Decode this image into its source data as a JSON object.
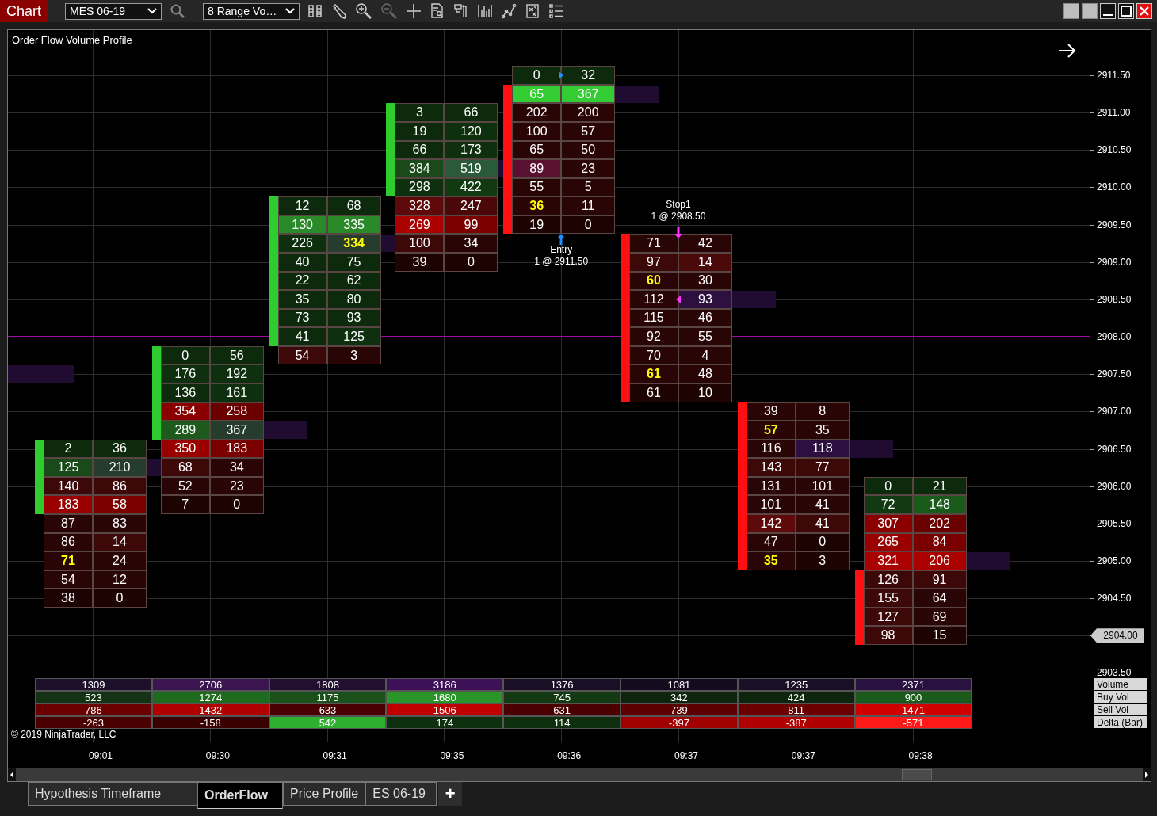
{
  "toolbar": {
    "title": "Chart",
    "instrument": "MES 06-19",
    "bar_type": "8 Range Vo…"
  },
  "chart": {
    "title": "Order Flow Volume Profile",
    "axis_labels": [
      {
        "text": "2911.50",
        "current": false
      },
      {
        "text": "2911.00",
        "current": false
      },
      {
        "text": "2910.50",
        "current": false
      },
      {
        "text": "2910.00",
        "current": false
      },
      {
        "text": "2909.50",
        "current": false
      },
      {
        "text": "2909.00",
        "current": false
      },
      {
        "text": "2908.50",
        "current": false
      },
      {
        "text": "2908.00",
        "current": false
      },
      {
        "text": "2907.50",
        "current": false
      },
      {
        "text": "2907.00",
        "current": false
      },
      {
        "text": "2906.50",
        "current": false
      },
      {
        "text": "2906.00",
        "current": false
      },
      {
        "text": "2905.50",
        "current": false
      },
      {
        "text": "2905.00",
        "current": false
      },
      {
        "text": "2904.50",
        "current": false
      },
      {
        "text": "2904.00",
        "current": true
      },
      {
        "text": "2903.50",
        "current": false
      }
    ],
    "columns": [
      {
        "time": "09:01",
        "kind": "up"
      },
      {
        "time": "09:30",
        "kind": "up"
      },
      {
        "time": "09:31",
        "kind": "up"
      },
      {
        "time": "09:35",
        "kind": "up"
      },
      {
        "time": "09:36",
        "kind": "down",
        "annotation": {
          "kind": "entry",
          "label": "Entry",
          "detail": "1 @ 2911.50"
        }
      },
      {
        "time": "09:37",
        "kind": "down",
        "annotation": {
          "kind": "stop",
          "label": "Stop1",
          "detail": "1 @ 2908.50"
        }
      },
      {
        "time": "09:37",
        "kind": "down"
      },
      {
        "time": "09:38",
        "kind": "down"
      }
    ],
    "ladder": [
      {
        "price_line": false,
        "profile_mark": false,
        "cells": [
          null,
          null,
          null,
          null,
          {
            "bid": {
              "text": "0",
              "color": "#0d2a0d",
              "highlight": false
            },
            "ask": {
              "text": "32",
              "color": "#0d2a0d",
              "highlight": false
            },
            "body": false,
            "poc": false,
            "pointer": {
              "kind": "right",
              "color": "#1e90ff"
            }
          },
          null,
          null,
          null
        ]
      },
      {
        "price_line": false,
        "profile_mark": false,
        "cells": [
          null,
          null,
          null,
          null,
          {
            "bid": {
              "text": "65",
              "color": "#33cc33",
              "highlight": false
            },
            "ask": {
              "text": "367",
              "color": "#33cc33",
              "highlight": false
            },
            "body": true,
            "poc": true
          },
          null,
          null,
          null
        ]
      },
      {
        "price_line": false,
        "profile_mark": false,
        "cells": [
          null,
          null,
          null,
          {
            "bid": {
              "text": "3",
              "color": "#0d2a0d",
              "highlight": false
            },
            "ask": {
              "text": "66",
              "color": "#0d2a0d",
              "highlight": false
            },
            "body": true,
            "poc": false
          },
          {
            "bid": {
              "text": "202",
              "color": "#2a0505",
              "highlight": false
            },
            "ask": {
              "text": "200",
              "color": "#2a0505",
              "highlight": false
            },
            "body": true,
            "poc": false
          },
          null,
          null,
          null
        ]
      },
      {
        "price_line": false,
        "profile_mark": false,
        "cells": [
          null,
          null,
          null,
          {
            "bid": {
              "text": "19",
              "color": "#0d2a0d",
              "highlight": false
            },
            "ask": {
              "text": "120",
              "color": "#0f300f",
              "highlight": false
            },
            "body": true,
            "poc": false
          },
          {
            "bid": {
              "text": "100",
              "color": "#2a0505",
              "highlight": false
            },
            "ask": {
              "text": "57",
              "color": "#2a0505",
              "highlight": false
            },
            "body": true,
            "poc": false
          },
          null,
          null,
          null
        ]
      },
      {
        "price_line": false,
        "profile_mark": false,
        "cells": [
          null,
          null,
          null,
          {
            "bid": {
              "text": "66",
              "color": "#0d2a0d",
              "highlight": false
            },
            "ask": {
              "text": "173",
              "color": "#0f300f",
              "highlight": false
            },
            "body": true,
            "poc": false
          },
          {
            "bid": {
              "text": "65",
              "color": "#2a0505",
              "highlight": false
            },
            "ask": {
              "text": "50",
              "color": "#2a0505",
              "highlight": false
            },
            "body": true,
            "poc": false
          },
          null,
          null,
          null
        ]
      },
      {
        "price_line": false,
        "profile_mark": false,
        "cells": [
          null,
          null,
          null,
          {
            "bid": {
              "text": "384",
              "color": "#1a4a1a",
              "highlight": false
            },
            "ask": {
              "text": "519",
              "color": "#2a5a3a",
              "highlight": false
            },
            "body": true,
            "poc": true
          },
          {
            "bid": {
              "text": "89",
              "color": "#5a1030",
              "highlight": false
            },
            "ask": {
              "text": "23",
              "color": "#2a0505",
              "highlight": false
            },
            "body": true,
            "poc": false
          },
          null,
          null,
          null
        ]
      },
      {
        "price_line": false,
        "profile_mark": false,
        "cells": [
          null,
          null,
          null,
          {
            "bid": {
              "text": "298",
              "color": "#0f300f",
              "highlight": false
            },
            "ask": {
              "text": "422",
              "color": "#123a12",
              "highlight": false
            },
            "body": true,
            "poc": false
          },
          {
            "bid": {
              "text": "55",
              "color": "#2a0505",
              "highlight": false
            },
            "ask": {
              "text": "5",
              "color": "#2a0505",
              "highlight": false
            },
            "body": true,
            "poc": false
          },
          null,
          null,
          null
        ]
      },
      {
        "price_line": false,
        "profile_mark": false,
        "cells": [
          null,
          null,
          {
            "bid": {
              "text": "12",
              "color": "#0d2a0d",
              "highlight": false
            },
            "ask": {
              "text": "68",
              "color": "#0d2a0d",
              "highlight": false
            },
            "body": true,
            "poc": false
          },
          {
            "bid": {
              "text": "328",
              "color": "#5e0a0a",
              "highlight": false
            },
            "ask": {
              "text": "247",
              "color": "#4a0808",
              "highlight": false
            },
            "body": false,
            "poc": false
          },
          {
            "bid": {
              "text": "36",
              "color": "#2a0505",
              "highlight": true
            },
            "ask": {
              "text": "11",
              "color": "#2a0505",
              "highlight": false
            },
            "body": true,
            "poc": false
          },
          null,
          null,
          null
        ]
      },
      {
        "price_line": false,
        "profile_mark": false,
        "cells": [
          null,
          null,
          {
            "bid": {
              "text": "130",
              "color": "#2a8a2a",
              "highlight": false
            },
            "ask": {
              "text": "335",
              "color": "#2a8a2a",
              "highlight": false
            },
            "body": true,
            "poc": false
          },
          {
            "bid": {
              "text": "269",
              "color": "#aa0000",
              "highlight": false
            },
            "ask": {
              "text": "99",
              "color": "#7a0000",
              "highlight": false
            },
            "body": false,
            "poc": false
          },
          {
            "bid": {
              "text": "19",
              "color": "#1e0303",
              "highlight": false
            },
            "ask": {
              "text": "0",
              "color": "#1e0303",
              "highlight": false
            },
            "body": true,
            "poc": false
          },
          null,
          null,
          null
        ]
      },
      {
        "price_line": false,
        "profile_mark": false,
        "cells": [
          null,
          null,
          {
            "bid": {
              "text": "226",
              "color": "#0f300f",
              "highlight": false
            },
            "ask": {
              "text": "334",
              "color": "#263d2e",
              "highlight": true
            },
            "body": true,
            "poc": true
          },
          {
            "bid": {
              "text": "100",
              "color": "#3d0808",
              "highlight": false
            },
            "ask": {
              "text": "34",
              "color": "#2a0505",
              "highlight": false
            },
            "body": false,
            "poc": false
          },
          null,
          {
            "bid": {
              "text": "71",
              "color": "#2a0505",
              "highlight": false
            },
            "ask": {
              "text": "42",
              "color": "#2a0505",
              "highlight": false
            },
            "body": true,
            "poc": false
          },
          null,
          null
        ]
      },
      {
        "price_line": false,
        "profile_mark": false,
        "cells": [
          null,
          null,
          {
            "bid": {
              "text": "40",
              "color": "#0d2a0d",
              "highlight": false
            },
            "ask": {
              "text": "75",
              "color": "#0d2a0d",
              "highlight": false
            },
            "body": true,
            "poc": false
          },
          {
            "bid": {
              "text": "39",
              "color": "#1e0303",
              "highlight": false
            },
            "ask": {
              "text": "0",
              "color": "#1e0303",
              "highlight": false
            },
            "body": false,
            "poc": false
          },
          null,
          {
            "bid": {
              "text": "97",
              "color": "#3d0808",
              "highlight": false
            },
            "ask": {
              "text": "14",
              "color": "#4a0a0a",
              "highlight": false
            },
            "body": true,
            "poc": false
          },
          null,
          null
        ]
      },
      {
        "price_line": false,
        "profile_mark": false,
        "cells": [
          null,
          null,
          {
            "bid": {
              "text": "22",
              "color": "#0d2a0d",
              "highlight": false
            },
            "ask": {
              "text": "62",
              "color": "#0d2a0d",
              "highlight": false
            },
            "body": true,
            "poc": false
          },
          null,
          null,
          {
            "bid": {
              "text": "60",
              "color": "#2a0505",
              "highlight": true
            },
            "ask": {
              "text": "30",
              "color": "#2a0505",
              "highlight": false
            },
            "body": true,
            "poc": false
          },
          null,
          null
        ]
      },
      {
        "price_line": false,
        "profile_mark": false,
        "cells": [
          null,
          null,
          {
            "bid": {
              "text": "35",
              "color": "#0d2a0d",
              "highlight": false
            },
            "ask": {
              "text": "80",
              "color": "#0d2a0d",
              "highlight": false
            },
            "body": true,
            "poc": false
          },
          null,
          null,
          {
            "bid": {
              "text": "112",
              "color": "#2a0505",
              "highlight": false
            },
            "ask": {
              "text": "93",
              "color": "#2e1040",
              "highlight": false
            },
            "body": true,
            "poc": true,
            "pointer": {
              "kind": "left",
              "color": "#ff33ff"
            }
          },
          null,
          null
        ]
      },
      {
        "price_line": false,
        "profile_mark": false,
        "cells": [
          null,
          null,
          {
            "bid": {
              "text": "73",
              "color": "#0d2a0d",
              "highlight": false
            },
            "ask": {
              "text": "93",
              "color": "#0d2a0d",
              "highlight": false
            },
            "body": true,
            "poc": false
          },
          null,
          null,
          {
            "bid": {
              "text": "115",
              "color": "#2a0505",
              "highlight": false
            },
            "ask": {
              "text": "46",
              "color": "#2a0505",
              "highlight": false
            },
            "body": true,
            "poc": false
          },
          null,
          null
        ]
      },
      {
        "price_line": true,
        "profile_mark": false,
        "cells": [
          null,
          null,
          {
            "bid": {
              "text": "41",
              "color": "#0d2a0d",
              "highlight": false
            },
            "ask": {
              "text": "125",
              "color": "#0f300f",
              "highlight": false
            },
            "body": true,
            "poc": false
          },
          null,
          null,
          {
            "bid": {
              "text": "92",
              "color": "#2a0505",
              "highlight": false
            },
            "ask": {
              "text": "55",
              "color": "#2a0505",
              "highlight": false
            },
            "body": true,
            "poc": false
          },
          null,
          null
        ]
      },
      {
        "price_line": false,
        "profile_mark": false,
        "cells": [
          null,
          {
            "bid": {
              "text": "0",
              "color": "#0d2a0d",
              "highlight": false
            },
            "ask": {
              "text": "56",
              "color": "#0d2a0d",
              "highlight": false
            },
            "body": true,
            "poc": false
          },
          {
            "bid": {
              "text": "54",
              "color": "#3d0808",
              "highlight": false
            },
            "ask": {
              "text": "3",
              "color": "#2a0505",
              "highlight": false
            },
            "body": false,
            "poc": false
          },
          null,
          null,
          {
            "bid": {
              "text": "70",
              "color": "#2a0505",
              "highlight": false
            },
            "ask": {
              "text": "4",
              "color": "#2a0505",
              "highlight": false
            },
            "body": true,
            "poc": false
          },
          null,
          null
        ]
      },
      {
        "price_line": false,
        "profile_mark": true,
        "cells": [
          null,
          {
            "bid": {
              "text": "176",
              "color": "#0f300f",
              "highlight": false
            },
            "ask": {
              "text": "192",
              "color": "#0f300f",
              "highlight": false
            },
            "body": true,
            "poc": false
          },
          null,
          null,
          null,
          {
            "bid": {
              "text": "61",
              "color": "#2a0505",
              "highlight": true
            },
            "ask": {
              "text": "48",
              "color": "#2a0505",
              "highlight": false
            },
            "body": true,
            "poc": false
          },
          null,
          null
        ]
      },
      {
        "price_line": false,
        "profile_mark": false,
        "cells": [
          null,
          {
            "bid": {
              "text": "136",
              "color": "#0d2a0d",
              "highlight": false
            },
            "ask": {
              "text": "161",
              "color": "#0f300f",
              "highlight": false
            },
            "body": true,
            "poc": false
          },
          null,
          null,
          null,
          {
            "bid": {
              "text": "61",
              "color": "#1e0303",
              "highlight": false
            },
            "ask": {
              "text": "10",
              "color": "#1e0303",
              "highlight": false
            },
            "body": true,
            "poc": false
          },
          null,
          null
        ]
      },
      {
        "price_line": false,
        "profile_mark": false,
        "cells": [
          null,
          {
            "bid": {
              "text": "354",
              "color": "#8a0000",
              "highlight": false
            },
            "ask": {
              "text": "258",
              "color": "#6b0000",
              "highlight": false
            },
            "body": true,
            "poc": false
          },
          null,
          null,
          null,
          null,
          {
            "bid": {
              "text": "39",
              "color": "#2a0505",
              "highlight": false
            },
            "ask": {
              "text": "8",
              "color": "#2a0505",
              "highlight": false
            },
            "body": true,
            "poc": false
          },
          null
        ]
      },
      {
        "price_line": false,
        "profile_mark": false,
        "cells": [
          null,
          {
            "bid": {
              "text": "289",
              "color": "#1e5a1e",
              "highlight": false
            },
            "ask": {
              "text": "367",
              "color": "#263d2e",
              "highlight": false
            },
            "body": true,
            "poc": true
          },
          null,
          null,
          null,
          null,
          {
            "bid": {
              "text": "57",
              "color": "#2a0505",
              "highlight": true
            },
            "ask": {
              "text": "35",
              "color": "#2a0505",
              "highlight": false
            },
            "body": true,
            "poc": false
          },
          null
        ]
      },
      {
        "price_line": false,
        "profile_mark": false,
        "cells": [
          {
            "bid": {
              "text": "2",
              "color": "#0d2a0d",
              "highlight": false
            },
            "ask": {
              "text": "36",
              "color": "#0d2a0d",
              "highlight": false
            },
            "body": true,
            "poc": false
          },
          {
            "bid": {
              "text": "350",
              "color": "#9b0000",
              "highlight": false
            },
            "ask": {
              "text": "183",
              "color": "#7a0000",
              "highlight": false
            },
            "body": false,
            "poc": false
          },
          null,
          null,
          null,
          null,
          {
            "bid": {
              "text": "116",
              "color": "#2a0505",
              "highlight": false
            },
            "ask": {
              "text": "118",
              "color": "#2e1040",
              "highlight": false
            },
            "body": true,
            "poc": true
          },
          null
        ]
      },
      {
        "price_line": false,
        "profile_mark": false,
        "cells": [
          {
            "bid": {
              "text": "125",
              "color": "#1a4a1a",
              "highlight": false
            },
            "ask": {
              "text": "210",
              "color": "#263d2e",
              "highlight": false
            },
            "body": true,
            "poc": true
          },
          {
            "bid": {
              "text": "68",
              "color": "#3d0808",
              "highlight": false
            },
            "ask": {
              "text": "34",
              "color": "#2a0505",
              "highlight": false
            },
            "body": false,
            "poc": false
          },
          null,
          null,
          null,
          null,
          {
            "bid": {
              "text": "143",
              "color": "#3d0808",
              "highlight": false
            },
            "ask": {
              "text": "77",
              "color": "#3d0808",
              "highlight": false
            },
            "body": true,
            "poc": false
          },
          null
        ]
      },
      {
        "price_line": false,
        "profile_mark": false,
        "cells": [
          {
            "bid": {
              "text": "140",
              "color": "#3d0808",
              "highlight": false
            },
            "ask": {
              "text": "86",
              "color": "#3d0808",
              "highlight": false
            },
            "body": true,
            "poc": false
          },
          {
            "bid": {
              "text": "52",
              "color": "#2a0505",
              "highlight": false
            },
            "ask": {
              "text": "23",
              "color": "#2a0505",
              "highlight": false
            },
            "body": false,
            "poc": false
          },
          null,
          null,
          null,
          null,
          {
            "bid": {
              "text": "131",
              "color": "#2a0505",
              "highlight": false
            },
            "ask": {
              "text": "101",
              "color": "#2a0505",
              "highlight": false
            },
            "body": true,
            "poc": false
          },
          {
            "bid": {
              "text": "0",
              "color": "#0d2a0d",
              "highlight": false
            },
            "ask": {
              "text": "21",
              "color": "#0d2a0d",
              "highlight": false
            },
            "body": false,
            "poc": false
          }
        ]
      },
      {
        "price_line": false,
        "profile_mark": false,
        "cells": [
          {
            "bid": {
              "text": "183",
              "color": "#9b0000",
              "highlight": false
            },
            "ask": {
              "text": "58",
              "color": "#7a0000",
              "highlight": false
            },
            "body": true,
            "poc": false
          },
          {
            "bid": {
              "text": "7",
              "color": "#1e0303",
              "highlight": false
            },
            "ask": {
              "text": "0",
              "color": "#1e0303",
              "highlight": false
            },
            "body": false,
            "poc": false
          },
          null,
          null,
          null,
          null,
          {
            "bid": {
              "text": "101",
              "color": "#2a0505",
              "highlight": false
            },
            "ask": {
              "text": "41",
              "color": "#2a0505",
              "highlight": false
            },
            "body": true,
            "poc": false
          },
          {
            "bid": {
              "text": "72",
              "color": "#123a12",
              "highlight": false
            },
            "ask": {
              "text": "148",
              "color": "#1a5a1a",
              "highlight": false
            },
            "body": false,
            "poc": false
          }
        ]
      },
      {
        "price_line": false,
        "profile_mark": false,
        "cells": [
          {
            "bid": {
              "text": "87",
              "color": "#2a0505",
              "highlight": false
            },
            "ask": {
              "text": "83",
              "color": "#2a0505",
              "highlight": false
            },
            "body": false,
            "poc": false
          },
          null,
          null,
          null,
          null,
          null,
          {
            "bid": {
              "text": "142",
              "color": "#5e0a0a",
              "highlight": false
            },
            "ask": {
              "text": "41",
              "color": "#3d0808",
              "highlight": false
            },
            "body": true,
            "poc": false
          },
          {
            "bid": {
              "text": "307",
              "color": "#8a0000",
              "highlight": false
            },
            "ask": {
              "text": "202",
              "color": "#6b0000",
              "highlight": false
            },
            "body": false,
            "poc": false
          }
        ]
      },
      {
        "price_line": false,
        "profile_mark": false,
        "cells": [
          {
            "bid": {
              "text": "86",
              "color": "#2a0505",
              "highlight": false
            },
            "ask": {
              "text": "14",
              "color": "#3d0808",
              "highlight": false
            },
            "body": false,
            "poc": false
          },
          null,
          null,
          null,
          null,
          null,
          {
            "bid": {
              "text": "47",
              "color": "#2a0505",
              "highlight": false
            },
            "ask": {
              "text": "0",
              "color": "#1e0303",
              "highlight": false
            },
            "body": true,
            "poc": false
          },
          {
            "bid": {
              "text": "265",
              "color": "#9b0000",
              "highlight": false
            },
            "ask": {
              "text": "84",
              "color": "#7a0000",
              "highlight": false
            },
            "body": false,
            "poc": false
          }
        ]
      },
      {
        "price_line": false,
        "profile_mark": false,
        "cells": [
          {
            "bid": {
              "text": "71",
              "color": "#2a0505",
              "highlight": true
            },
            "ask": {
              "text": "24",
              "color": "#2a0505",
              "highlight": false
            },
            "body": false,
            "poc": false
          },
          null,
          null,
          null,
          null,
          null,
          {
            "bid": {
              "text": "35",
              "color": "#2a0505",
              "highlight": true
            },
            "ask": {
              "text": "3",
              "color": "#1e0303",
              "highlight": false
            },
            "body": true,
            "poc": false
          },
          {
            "bid": {
              "text": "321",
              "color": "#aa0000",
              "highlight": false
            },
            "ask": {
              "text": "206",
              "color": "#aa0000",
              "highlight": false
            },
            "body": false,
            "poc": true
          }
        ]
      },
      {
        "price_line": false,
        "profile_mark": false,
        "cells": [
          {
            "bid": {
              "text": "54",
              "color": "#2a0505",
              "highlight": false
            },
            "ask": {
              "text": "12",
              "color": "#2a0505",
              "highlight": false
            },
            "body": false,
            "poc": false
          },
          null,
          null,
          null,
          null,
          null,
          null,
          {
            "bid": {
              "text": "126",
              "color": "#3d0808",
              "highlight": false
            },
            "ask": {
              "text": "91",
              "color": "#3d0808",
              "highlight": false
            },
            "body": true,
            "poc": false
          }
        ]
      },
      {
        "price_line": false,
        "profile_mark": false,
        "cells": [
          {
            "bid": {
              "text": "38",
              "color": "#1e0303",
              "highlight": false
            },
            "ask": {
              "text": "0",
              "color": "#1e0303",
              "highlight": false
            },
            "body": false,
            "poc": false
          },
          null,
          null,
          null,
          null,
          null,
          null,
          {
            "bid": {
              "text": "155",
              "color": "#3d0808",
              "highlight": false
            },
            "ask": {
              "text": "64",
              "color": "#2a0505",
              "highlight": false
            },
            "body": true,
            "poc": false
          }
        ]
      },
      {
        "price_line": false,
        "profile_mark": false,
        "cells": [
          null,
          null,
          null,
          null,
          null,
          null,
          null,
          {
            "bid": {
              "text": "127",
              "color": "#3d0808",
              "highlight": false
            },
            "ask": {
              "text": "69",
              "color": "#2a0505",
              "highlight": false
            },
            "body": true,
            "poc": false
          }
        ]
      },
      {
        "price_line": false,
        "profile_mark": false,
        "cells": [
          null,
          null,
          null,
          null,
          null,
          null,
          null,
          {
            "bid": {
              "text": "98",
              "color": "#3d0808",
              "highlight": false
            },
            "ask": {
              "text": "15",
              "color": "#1e0303",
              "highlight": false
            },
            "body": true,
            "poc": false
          }
        ]
      }
    ],
    "summary": [
      {
        "label": "Volume",
        "cells": [
          {
            "text": "1309",
            "color": "#1e0f2a"
          },
          {
            "text": "2706",
            "color": "#3a1550"
          },
          {
            "text": "1808",
            "color": "#200f2e"
          },
          {
            "text": "3186",
            "color": "#3e1058"
          },
          {
            "text": "1376",
            "color": "#1a0f25"
          },
          {
            "text": "1081",
            "color": "#150a1e"
          },
          {
            "text": "1235",
            "color": "#1a0f25"
          },
          {
            "text": "2371",
            "color": "#2a1240"
          }
        ]
      },
      {
        "label": "Buy Vol",
        "cells": [
          {
            "text": "523",
            "color": "#143214"
          },
          {
            "text": "1274",
            "color": "#1e6b1e"
          },
          {
            "text": "1175",
            "color": "#1a501a"
          },
          {
            "text": "1680",
            "color": "#2a962a"
          },
          {
            "text": "745",
            "color": "#143a14"
          },
          {
            "text": "342",
            "color": "#0c250c"
          },
          {
            "text": "424",
            "color": "#0c250c"
          },
          {
            "text": "900",
            "color": "#1a5a1a"
          }
        ]
      },
      {
        "label": "Sell Vol",
        "cells": [
          {
            "text": "786",
            "color": "#6a0000"
          },
          {
            "text": "1432",
            "color": "#b00000"
          },
          {
            "text": "633",
            "color": "#4a0000"
          },
          {
            "text": "1506",
            "color": "#c00000"
          },
          {
            "text": "631",
            "color": "#4a0000"
          },
          {
            "text": "739",
            "color": "#5a0000"
          },
          {
            "text": "811",
            "color": "#6a0000"
          },
          {
            "text": "1471",
            "color": "#d00000"
          }
        ]
      },
      {
        "label": "Delta (Bar)",
        "cells": [
          {
            "text": "-263",
            "color": "#4a0000"
          },
          {
            "text": "-158",
            "color": "#3a0000"
          },
          {
            "text": "542",
            "color": "#2eb02e"
          },
          {
            "text": "174",
            "color": "#0f300f"
          },
          {
            "text": "114",
            "color": "#0f300f"
          },
          {
            "text": "-397",
            "color": "#a00000"
          },
          {
            "text": "-387",
            "color": "#b00000"
          },
          {
            "text": "-571",
            "color": "#ff1a1a"
          }
        ]
      }
    ],
    "copyright": "© 2019 NinjaTrader, LLC"
  },
  "tabs": [
    {
      "label": "Hypothesis Timeframe",
      "selected": false
    },
    {
      "label": "OrderFlow",
      "selected": true
    },
    {
      "label": "Price Profile",
      "selected": false
    },
    {
      "label": "ES 06-19",
      "selected": false
    }
  ],
  "add_tab": "+"
}
